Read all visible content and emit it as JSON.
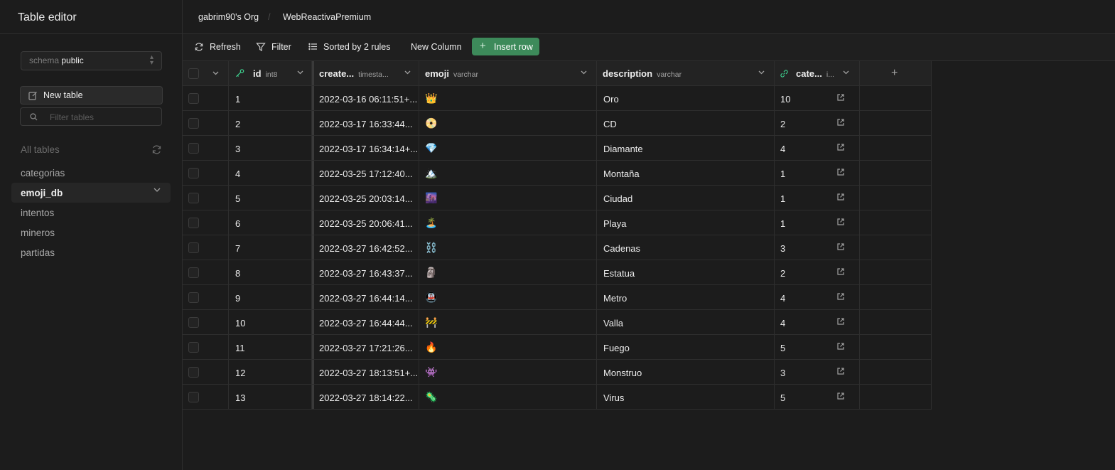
{
  "sidebar": {
    "title": "Table editor",
    "schema_label": "schema",
    "schema_value": "public",
    "new_table_label": "New table",
    "filter_placeholder": "Filter tables",
    "all_tables_label": "All tables",
    "tables": [
      {
        "name": "categorias",
        "active": false
      },
      {
        "name": "emoji_db",
        "active": true
      },
      {
        "name": "intentos",
        "active": false
      },
      {
        "name": "mineros",
        "active": false
      },
      {
        "name": "partidas",
        "active": false
      }
    ]
  },
  "breadcrumb": {
    "org": "gabrim90's Org",
    "separator": "/",
    "project": "WebReactivaPremium"
  },
  "toolbar": {
    "refresh_label": "Refresh",
    "filter_label": "Filter",
    "sort_label": "Sorted by 2 rules",
    "new_column_label": "New Column",
    "insert_row_label": "Insert row",
    "insert_row_plus": "+"
  },
  "grid": {
    "columns": {
      "id": {
        "name": "id",
        "type": "int8"
      },
      "created": {
        "name": "create...",
        "type": "timesta..."
      },
      "emoji": {
        "name": "emoji",
        "type": "varchar"
      },
      "description": {
        "name": "description",
        "type": "varchar"
      },
      "categoria": {
        "name": "cate...",
        "type": "i..."
      },
      "add": "+"
    },
    "rows": [
      {
        "id": "1",
        "created": "2022-03-16 06:11:51+...",
        "emoji": "👑",
        "description": "Oro",
        "cat": "10"
      },
      {
        "id": "2",
        "created": "2022-03-17 16:33:44...",
        "emoji": "📀",
        "description": "CD",
        "cat": "2"
      },
      {
        "id": "3",
        "created": "2022-03-17 16:34:14+...",
        "emoji": "💎",
        "description": "Diamante",
        "cat": "4"
      },
      {
        "id": "4",
        "created": "2022-03-25 17:12:40...",
        "emoji": "🏔️",
        "description": "Montaña",
        "cat": "1"
      },
      {
        "id": "5",
        "created": "2022-03-25 20:03:14...",
        "emoji": "🌆",
        "description": "Ciudad",
        "cat": "1"
      },
      {
        "id": "6",
        "created": "2022-03-25 20:06:41...",
        "emoji": "🏝️",
        "description": "Playa",
        "cat": "1"
      },
      {
        "id": "7",
        "created": "2022-03-27 16:42:52...",
        "emoji": "⛓️",
        "description": "Cadenas",
        "cat": "3"
      },
      {
        "id": "8",
        "created": "2022-03-27 16:43:37...",
        "emoji": "🗿",
        "description": "Estatua",
        "cat": "2"
      },
      {
        "id": "9",
        "created": "2022-03-27 16:44:14...",
        "emoji": "🚇",
        "description": "Metro",
        "cat": "4"
      },
      {
        "id": "10",
        "created": "2022-03-27 16:44:44...",
        "emoji": "🚧",
        "description": "Valla",
        "cat": "4"
      },
      {
        "id": "11",
        "created": "2022-03-27 17:21:26...",
        "emoji": "🔥",
        "description": "Fuego",
        "cat": "5"
      },
      {
        "id": "12",
        "created": "2022-03-27 18:13:51+...",
        "emoji": "👾",
        "description": "Monstruo",
        "cat": "3"
      },
      {
        "id": "13",
        "created": "2022-03-27 18:14:22...",
        "emoji": "🦠",
        "description": "Virus",
        "cat": "5"
      }
    ]
  },
  "colors": {
    "accent": "#3d8a5a",
    "background": "#1c1c1c",
    "border": "#2e2e2e"
  }
}
